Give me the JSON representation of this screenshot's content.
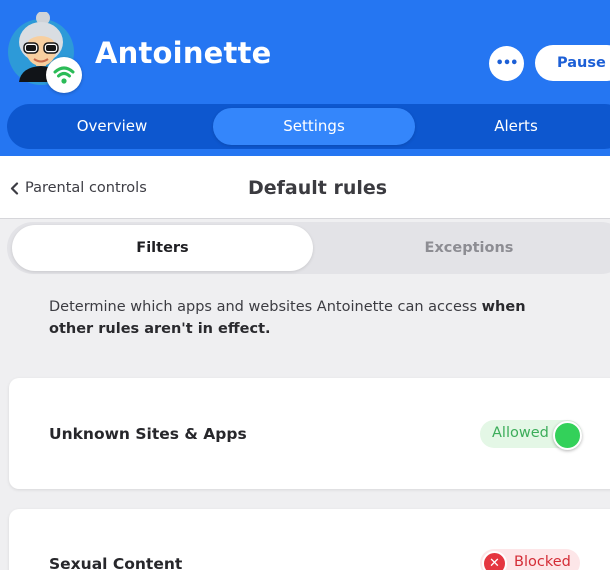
{
  "header": {
    "profile_name": "Antoinette",
    "more_label": "•••",
    "pause_label": "Pause"
  },
  "tabs": [
    {
      "label": "Overview",
      "active": false
    },
    {
      "label": "Settings",
      "active": true
    },
    {
      "label": "Alerts",
      "active": false
    }
  ],
  "subheader": {
    "back_label": "Parental controls",
    "title": "Default rules"
  },
  "segments": [
    {
      "label": "Filters",
      "active": true
    },
    {
      "label": "Exceptions",
      "active": false
    }
  ],
  "description": {
    "text": "Determine which apps and websites Antoinette can access ",
    "bold": "when other rules aren't in effect."
  },
  "rules": [
    {
      "label": "Unknown Sites & Apps",
      "status": "Allowed",
      "status_color": "#33d15a"
    },
    {
      "label": "Sexual Content",
      "status": "Blocked",
      "status_color": "#e53640"
    }
  ],
  "icons": {
    "avatar": "avatar-icon",
    "wifi": "wifi-icon",
    "back": "chevron-left-icon",
    "blocked": "x-icon"
  },
  "colors": {
    "brand_blue": "#2576f2",
    "tab_bar": "#0d57cf",
    "active_tab": "#3486fb"
  }
}
